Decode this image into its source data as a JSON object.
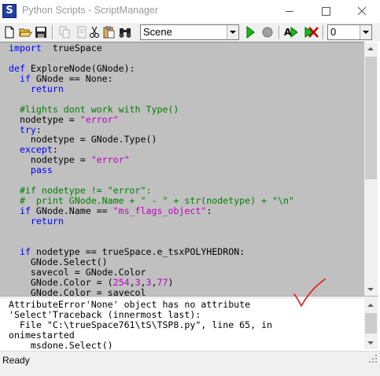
{
  "window": {
    "title": "Python Scripts - ScriptManager",
    "app_icon_letter": "S"
  },
  "toolbar": {
    "scene_select": "Scene",
    "number_select": "0"
  },
  "editor": {
    "lines": [
      [
        [
          "kw",
          "import"
        ],
        [
          "",
          "  trueSpace"
        ]
      ],
      [],
      [
        [
          "kw",
          "def"
        ],
        [
          "",
          " ExploreNode(GNode):"
        ]
      ],
      [
        [
          "",
          "  "
        ],
        [
          "kw",
          "if"
        ],
        [
          "",
          " GNode == None:"
        ]
      ],
      [
        [
          "",
          "    "
        ],
        [
          "kw",
          "return"
        ]
      ],
      [],
      [
        [
          "cm",
          "  #lights dont work with Type()"
        ]
      ],
      [
        [
          "",
          "  nodetype = "
        ],
        [
          "st",
          "\"error\""
        ]
      ],
      [
        [
          "",
          "  "
        ],
        [
          "kw",
          "try"
        ],
        [
          "",
          ":"
        ]
      ],
      [
        [
          "",
          "    nodetype = GNode.Type()"
        ]
      ],
      [
        [
          "",
          "  "
        ],
        [
          "kw",
          "except"
        ],
        [
          "",
          ":"
        ]
      ],
      [
        [
          "",
          "    nodetype = "
        ],
        [
          "st",
          "\"error\""
        ]
      ],
      [
        [
          "",
          "    "
        ],
        [
          "kw",
          "pass"
        ]
      ],
      [],
      [
        [
          "cm",
          "  #if nodetype != \"error\":"
        ]
      ],
      [
        [
          "cm",
          "  #  print GNode.Name + \" - \" + str(nodetype) + \"\\n\""
        ]
      ],
      [
        [
          "",
          "  "
        ],
        [
          "kw",
          "if"
        ],
        [
          "",
          " GNode.Name == "
        ],
        [
          "st",
          "\"ms_flags_object\""
        ],
        [
          "",
          ":"
        ]
      ],
      [
        [
          "",
          "    "
        ],
        [
          "kw",
          "return"
        ]
      ],
      [],
      [],
      [
        [
          "",
          "  "
        ],
        [
          "kw",
          "if"
        ],
        [
          "",
          " nodetype == trueSpace.e_tsxPOLYHEDRON:"
        ]
      ],
      [
        [
          "",
          "    GNode.Select()"
        ]
      ],
      [
        [
          "",
          "    savecol = GNode.Color"
        ]
      ],
      [
        [
          "",
          "    GNode.Color = ("
        ],
        [
          "nm",
          "254"
        ],
        [
          "",
          ","
        ],
        [
          "nm",
          "3"
        ],
        [
          "",
          ","
        ],
        [
          "nm",
          "3"
        ],
        [
          "",
          ","
        ],
        [
          "nm",
          "77"
        ],
        [
          "",
          ")"
        ]
      ],
      [
        [
          "",
          "    GNode.Color = savecol"
        ]
      ]
    ]
  },
  "output": {
    "lines": [
      "AttributeError'None' object has no attribute",
      "'Select'Traceback (innermost last):",
      "  File \"C:\\trueSpace761\\tS\\TSP8.py\", line 65, in",
      "onimestarted",
      "    msdone.Select()"
    ]
  },
  "status": {
    "text": "Ready"
  },
  "colors": {
    "keyword": "#0000ff",
    "comment": "#008000",
    "string": "#c000c0",
    "editor_bg": "#c0c0c0",
    "checkmark": "#e81818"
  }
}
